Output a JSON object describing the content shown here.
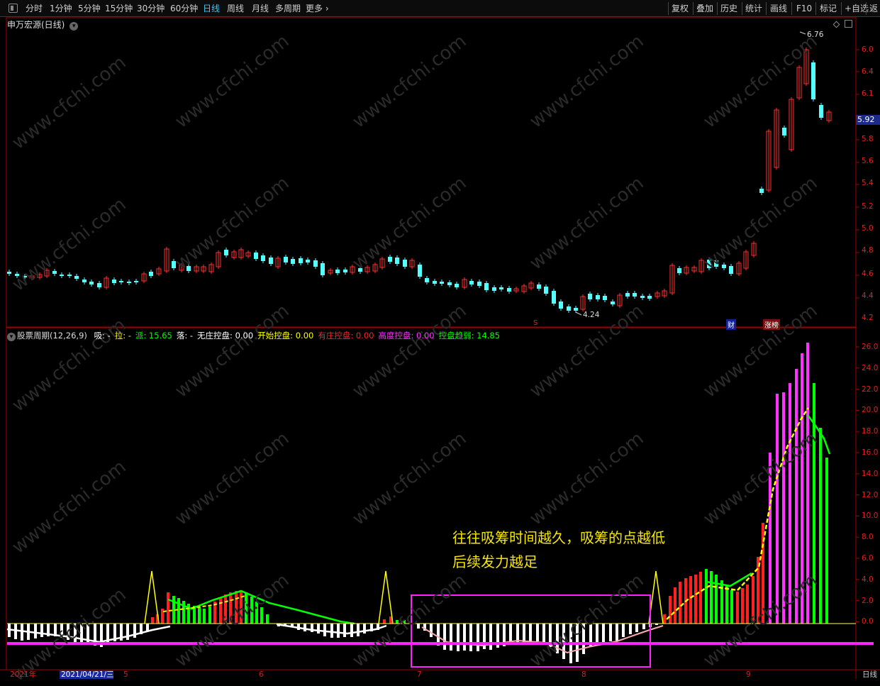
{
  "toolbar": {
    "periods": [
      "分时",
      "1分钟",
      "5分钟",
      "15分钟",
      "30分钟",
      "60分钟",
      "日线",
      "周线",
      "月线",
      "多周期",
      "更多"
    ],
    "active_period": "日线",
    "right_buttons": [
      "复权",
      "叠加",
      "历史",
      "统计",
      "画线",
      "F10",
      "标记",
      "+自选",
      "返"
    ]
  },
  "main_chart": {
    "stock_name": "申万宏源(日线)",
    "high_label": "6.76",
    "low_label": "4.24",
    "current_price": "5.92",
    "markers": [
      "S",
      "财",
      "涨榜"
    ],
    "price_ticks": [
      "6.0",
      "6.4",
      "6.1",
      "5.92",
      "5.8",
      "5.6",
      "5.4",
      "5.2",
      "5.0",
      "4.8",
      "4.6",
      "4.4",
      "4.2"
    ]
  },
  "sub_chart": {
    "indicator": "股票周期(12,26,9)",
    "params": [
      {
        "label": "吸:",
        "value": "-",
        "color": "#ffffff"
      },
      {
        "label": "拉:",
        "value": "-",
        "color": "#ffff00"
      },
      {
        "label": "派:",
        "value": "15.65",
        "color": "#00ff00"
      },
      {
        "label": "落:",
        "value": "-",
        "color": "#ffffff"
      },
      {
        "label": "无庄控盘:",
        "value": "0.00",
        "color": "#ffffff"
      },
      {
        "label": "开始控盘:",
        "value": "0.00",
        "color": "#ffff00"
      },
      {
        "label": "有庄控盘:",
        "value": "0.00",
        "color": "#ff2020"
      },
      {
        "label": "高度控盘:",
        "value": "0.00",
        "color": "#ff33ff"
      },
      {
        "label": "控盘趋弱:",
        "value": "14.85",
        "color": "#00ff00"
      }
    ],
    "y_ticks": [
      "26.0",
      "24.0",
      "22.0",
      "20.0",
      "18.0",
      "16.0",
      "14.0",
      "12.0",
      "10.0",
      "8.0",
      "6.0",
      "4.0",
      "2.0",
      "0.0"
    ]
  },
  "annotation": {
    "line1": "往往吸筹时间越久，吸筹的点越低",
    "line2": "后续发力越足"
  },
  "date_axis": {
    "year": "2021年",
    "highlight_date": "2021/04/21/三",
    "months": [
      "5",
      "6",
      "7",
      "8",
      "9"
    ],
    "right_label": "日线"
  },
  "watermark": "www.cfchi.com",
  "colors": {
    "up": "#ff3030",
    "down": "#54ffff",
    "grid": "#a00000",
    "accent": "#33ccff"
  }
}
